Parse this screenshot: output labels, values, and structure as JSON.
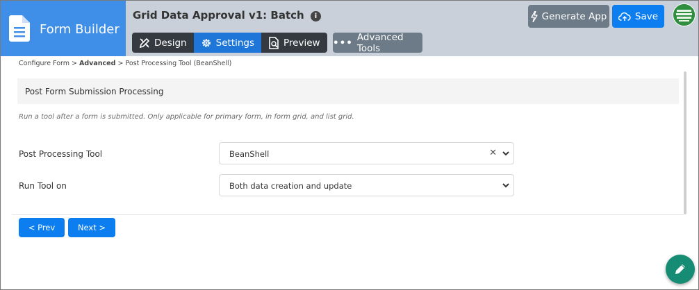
{
  "brand": {
    "label": "Form Builder",
    "icon": "document-icon",
    "color": "#3f8ee8"
  },
  "header": {
    "title": "Grid Data Approval v1: Batch",
    "info_icon": "i",
    "tabs": [
      {
        "label": "Design",
        "icon": "pencil-ruler-icon",
        "active": false
      },
      {
        "label": "Settings",
        "icon": "gear-icon",
        "active": true
      },
      {
        "label": "Preview",
        "icon": "preview-icon",
        "active": false
      }
    ],
    "advanced_tools": "Advanced Tools",
    "generate_app": "Generate App",
    "save": "Save"
  },
  "breadcrumb": {
    "item1": "Configure Form",
    "sep": ">",
    "item2": "Advanced",
    "item3": "Post Processing Tool (BeanShell)"
  },
  "panel": {
    "heading": "Post Form Submission Processing",
    "description": "Run a tool after a form is submitted. Only applicable for primary form, in form grid, and list grid.",
    "fields": [
      {
        "label": "Post Processing Tool",
        "value": "BeanShell",
        "clear_icon": "✕"
      },
      {
        "label": "Run Tool on",
        "value": "Both data creation and update"
      }
    ]
  },
  "nav": {
    "prev": "< Prev",
    "next": "Next >"
  },
  "colors": {
    "primary": "#0d7ef0",
    "dark": "#343a40",
    "secondary": "#6d7b88",
    "fab": "#178c75"
  }
}
